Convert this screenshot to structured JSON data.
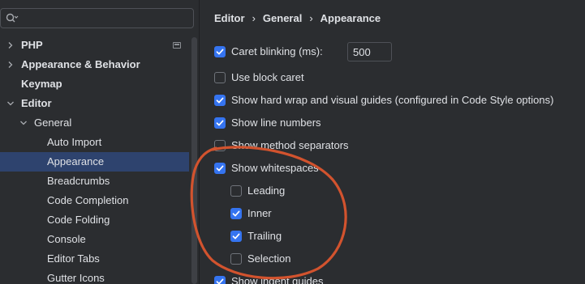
{
  "search": {
    "value": "",
    "placeholder": ""
  },
  "sidebar": {
    "items": [
      {
        "label": "PHP",
        "expanded": false,
        "has_arrow": true,
        "badge": true
      },
      {
        "label": "Appearance & Behavior",
        "expanded": false,
        "has_arrow": true
      },
      {
        "label": "Keymap",
        "has_arrow": false
      },
      {
        "label": "Editor",
        "expanded": true,
        "has_arrow": true
      },
      {
        "label": "General",
        "expanded": true,
        "has_arrow": true
      },
      {
        "label": "Auto Import"
      },
      {
        "label": "Appearance",
        "selected": true
      },
      {
        "label": "Breadcrumbs"
      },
      {
        "label": "Code Completion"
      },
      {
        "label": "Code Folding"
      },
      {
        "label": "Console"
      },
      {
        "label": "Editor Tabs"
      },
      {
        "label": "Gutter Icons"
      }
    ]
  },
  "breadcrumb": {
    "items": [
      "Editor",
      "General",
      "Appearance"
    ],
    "separator": "›"
  },
  "options": {
    "caret_blinking": {
      "label": "Caret blinking (ms):",
      "checked": true,
      "value": "500"
    },
    "block_caret": {
      "label": "Use block caret",
      "checked": false
    },
    "hard_wrap": {
      "label": "Show hard wrap and visual guides (configured in Code Style options)",
      "checked": true
    },
    "line_numbers": {
      "label": "Show line numbers",
      "checked": true
    },
    "method_separators": {
      "label": "Show method separators",
      "checked": false
    },
    "whitespaces": {
      "label": "Show whitespaces",
      "checked": true
    },
    "leading": {
      "label": "Leading",
      "checked": false
    },
    "inner": {
      "label": "Inner",
      "checked": true
    },
    "trailing": {
      "label": "Trailing",
      "checked": true
    },
    "selection": {
      "label": "Selection",
      "checked": false
    },
    "indent_guides": {
      "label": "Show indent guides",
      "checked": true
    }
  },
  "colors": {
    "accent": "#3574f0",
    "selection": "#2e436e",
    "annotation": "#d2532e",
    "background": "#2b2d30"
  }
}
